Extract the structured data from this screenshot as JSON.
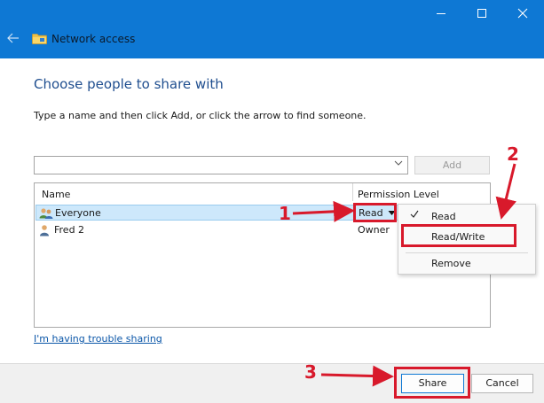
{
  "window": {
    "title": "Network access"
  },
  "heading": "Choose people to share with",
  "instruction": "Type a name and then click Add, or click the arrow to find someone.",
  "add_button": "Add",
  "list": {
    "columns": [
      "Name",
      "Permission Level"
    ],
    "rows": [
      {
        "name": "Everyone",
        "permission": "Read"
      },
      {
        "name": "Fred 2",
        "permission": "Owner"
      }
    ]
  },
  "menu": {
    "items": [
      {
        "label": "Read",
        "checked": true
      },
      {
        "label": "Read/Write",
        "checked": false
      },
      {
        "label": "Remove",
        "checked": false
      }
    ]
  },
  "trouble_link": "I'm having trouble sharing",
  "buttons": {
    "share": "Share",
    "cancel": "Cancel"
  },
  "annotations": {
    "step1": "1",
    "step2": "2",
    "step3": "3"
  },
  "colors": {
    "titlebar": "#0e78d4",
    "heading": "#1f4e8f",
    "annotation": "#d8192b",
    "selection": "#cde8fb"
  },
  "icons": [
    "minimize-icon",
    "maximize-icon",
    "close-icon",
    "back-arrow-icon",
    "folder-icon",
    "group-users-icon",
    "user-icon",
    "chevron-down-icon",
    "checkmark-icon",
    "dropdown-triangle-icon"
  ]
}
